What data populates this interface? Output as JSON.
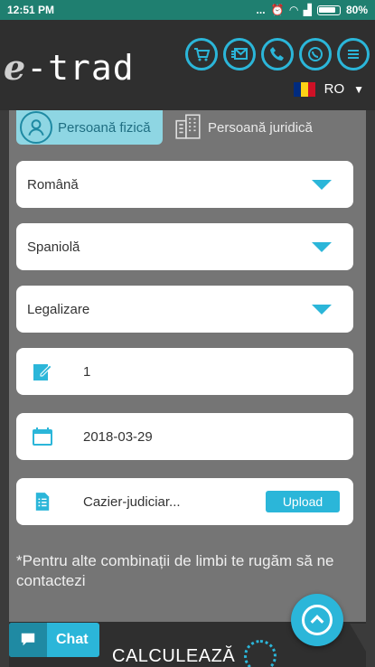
{
  "status": {
    "time": "12:51 PM",
    "dots": "...",
    "battery": "80%"
  },
  "header": {
    "logo_e": "e",
    "logo_text": "-trad",
    "language": "RO",
    "icons": [
      "cart-icon",
      "message-icon",
      "phone-icon",
      "whatsapp-icon",
      "menu-icon"
    ]
  },
  "tabs": {
    "person": "Persoană fizică",
    "company": "Persoană juridică"
  },
  "form": {
    "source_language": "Română",
    "target_language": "Spaniolă",
    "service": "Legalizare",
    "pages": "1",
    "date": "2018-03-29",
    "file_name": "Cazier-judiciar...",
    "upload_label": "Upload"
  },
  "note": "*Pentru alte combinații de limbi te rugăm să ne contactezi",
  "calculate_label": "CALCULEAZĂ",
  "chat_label": "Chat",
  "colors": {
    "accent": "#2bb6d9",
    "header": "#2f2f2f",
    "status": "#1f7f70"
  }
}
